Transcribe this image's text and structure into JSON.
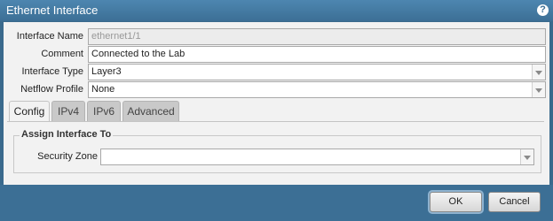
{
  "dialog": {
    "title": "Ethernet Interface",
    "help_icon": "?"
  },
  "form": {
    "interface_name": {
      "label": "Interface Name",
      "value": "ethernet1/1"
    },
    "comment": {
      "label": "Comment",
      "value": "Connected to the Lab"
    },
    "interface_type": {
      "label": "Interface Type",
      "value": "Layer3"
    },
    "netflow_profile": {
      "label": "Netflow Profile",
      "value": "None"
    }
  },
  "tabs": [
    {
      "label": "Config",
      "active": true
    },
    {
      "label": "IPv4"
    },
    {
      "label": "IPv6"
    },
    {
      "label": "Advanced"
    }
  ],
  "assign": {
    "legend": "Assign Interface To",
    "security_zone": {
      "label": "Security Zone",
      "value": ""
    }
  },
  "footer": {
    "ok": "OK",
    "cancel": "Cancel"
  },
  "icons": [
    "help-icon",
    "chevron-down-icon"
  ],
  "colors": {
    "titlebar": "#3c6f95",
    "panel": "#f2f2f2",
    "tab_inactive": "#c9c9c9"
  }
}
